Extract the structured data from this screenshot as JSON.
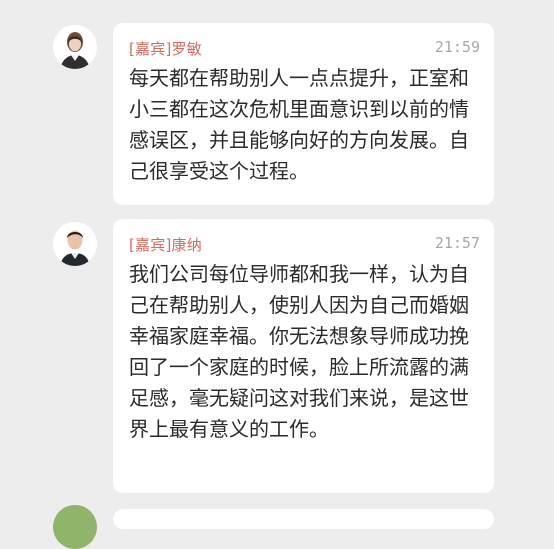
{
  "messages": [
    {
      "sender": "[嘉宾]罗敏",
      "time": "21:59",
      "text": "每天都在帮助别人一点点提升，正室和小三都在这次危机里面意识到以前的情感误区，并且能够向好的方向发展。自己很享受这个过程。"
    },
    {
      "sender": "[嘉宾]康纳",
      "time": "21:57",
      "text": "我们公司每位导师都和我一样，认为自己在帮助别人，使别人因为自己而婚姻幸福家庭幸福。你无法想象导师成功挽回了一个家庭的时候，脸上所流露的满足感，毫无疑问这对我们来说，是这世界上最有意义的工作。"
    }
  ],
  "colors": {
    "background": "#ededed",
    "sender": "#d66a5b",
    "timestamp": "#a8a8a8",
    "message_text": "#2b2b2b",
    "bubble": "#ffffff",
    "avatar_green": "#8fb56b"
  },
  "icons": {
    "message1_avatar": "avatar-woman-photo-icon",
    "message2_avatar": "avatar-man-photo-icon",
    "next_avatar": "avatar-green-icon"
  }
}
